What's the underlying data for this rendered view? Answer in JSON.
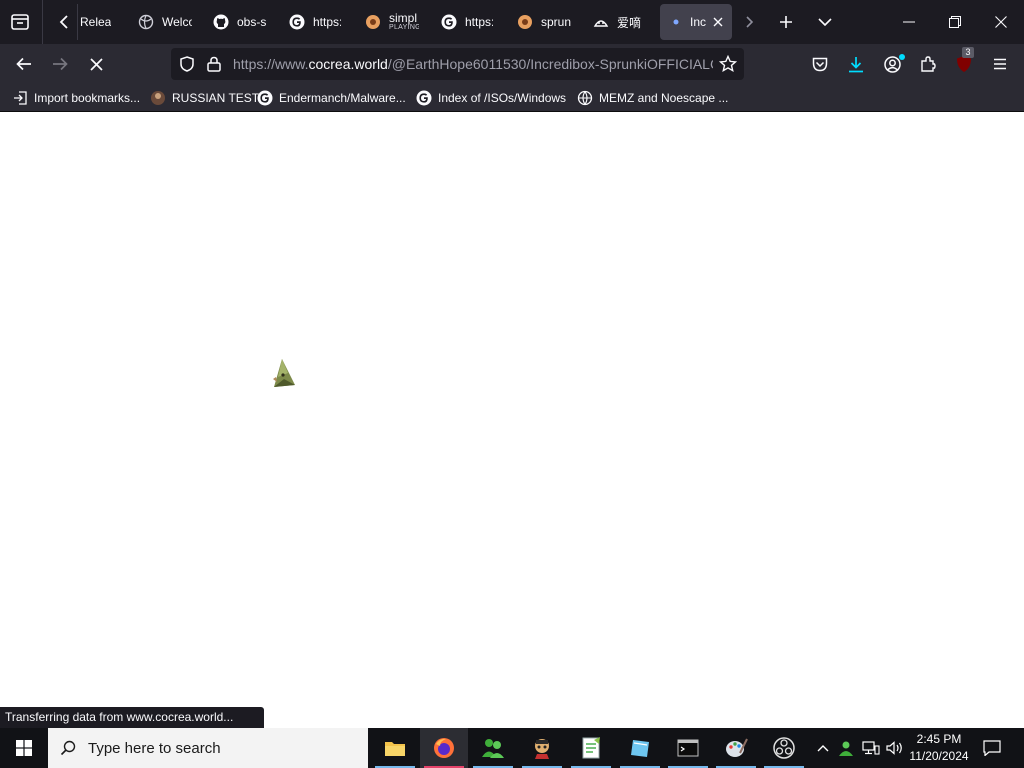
{
  "browser": {
    "tabs": [
      {
        "label": "Relea",
        "icon": "chevron-left-icon"
      },
      {
        "label": "Welco",
        "icon": "globe-icon"
      },
      {
        "label": "obs-s",
        "icon": "github-icon"
      },
      {
        "label": "https:",
        "icon": "google-icon"
      },
      {
        "label": "simpl",
        "sublabel": "PLAYING",
        "icon": "site-icon"
      },
      {
        "label": "https:",
        "icon": "google-icon"
      },
      {
        "label": "sprun",
        "icon": "site-icon"
      },
      {
        "label": "爱嘀",
        "icon": "site-icon"
      },
      {
        "label": "Inc",
        "icon": "loading-dot-icon",
        "active": true
      }
    ],
    "url": {
      "prefix": "https://www.",
      "domain": "cocrea.world",
      "path": "/@EarthHope6011530/Incredibox-SprunkiOFFICIALC"
    },
    "bookmarks": [
      {
        "label": "Import bookmarks...",
        "icon": "import-icon"
      },
      {
        "label": "RUSSIAN TEST",
        "icon": "profile-icon"
      },
      {
        "label": "Endermanch/Malware...",
        "icon": "google-icon"
      },
      {
        "label": "Index of /ISOs/Windows",
        "icon": "google-icon"
      },
      {
        "label": "MEMZ and Noescape ...",
        "icon": "globe-icon"
      }
    ],
    "status_text": "Transferring data from www.cocrea.world...",
    "extension_badge": "3"
  },
  "taskbar": {
    "search_placeholder": "Type here to search",
    "time": "2:45 PM",
    "date": "11/20/2024"
  },
  "colors": {
    "tabstrip": "#1c1b22",
    "toolbar": "#2b2a33",
    "accent": "#00ddff",
    "taskbar": "#111216"
  }
}
